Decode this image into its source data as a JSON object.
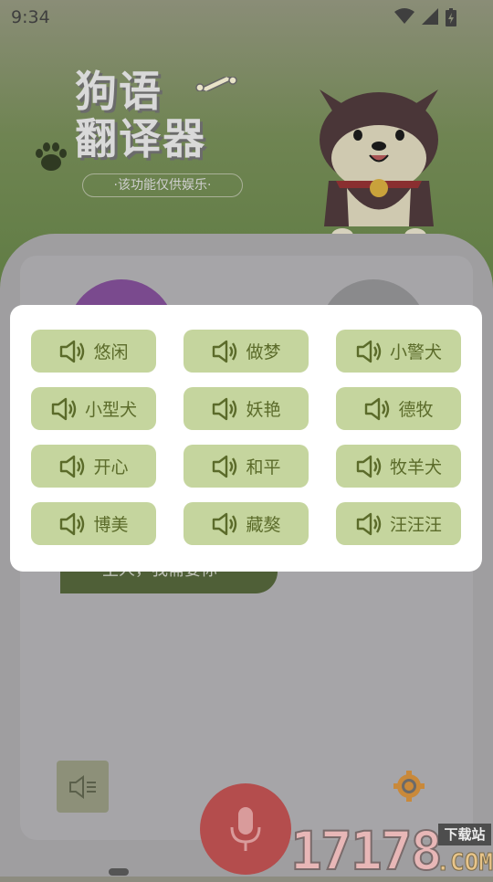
{
  "status_bar": {
    "time": "9:34"
  },
  "header": {
    "title_line1": "狗语",
    "title_line2": "翻译器",
    "subtitle": "·该功能仅供娱乐·"
  },
  "chat": {
    "bubble_text": "主人，我需要你"
  },
  "sound_buttons": [
    {
      "label": "悠闲"
    },
    {
      "label": "做梦"
    },
    {
      "label": "小警犬"
    },
    {
      "label": "小型犬"
    },
    {
      "label": "妖艳"
    },
    {
      "label": "德牧"
    },
    {
      "label": "开心"
    },
    {
      "label": "和平"
    },
    {
      "label": "牧羊犬"
    },
    {
      "label": "博美"
    },
    {
      "label": "藏獒"
    },
    {
      "label": "汪汪汪"
    }
  ],
  "watermark": {
    "number": "17178",
    "tag": "下载站",
    "suffix": ".COM"
  },
  "icons": {
    "wifi": "wifi-icon",
    "signal": "signal-icon",
    "battery": "battery-charging-icon",
    "paw": "paw-icon",
    "bone": "bone-icon",
    "speaker": "speaker-icon",
    "volume": "volume-icon",
    "gear": "gear-icon",
    "mic": "microphone-icon"
  },
  "colors": {
    "button_bg": "#c5d59e",
    "button_text": "#5b6b2a",
    "mic": "#b44d4d",
    "modal_bg": "#ffffff"
  }
}
